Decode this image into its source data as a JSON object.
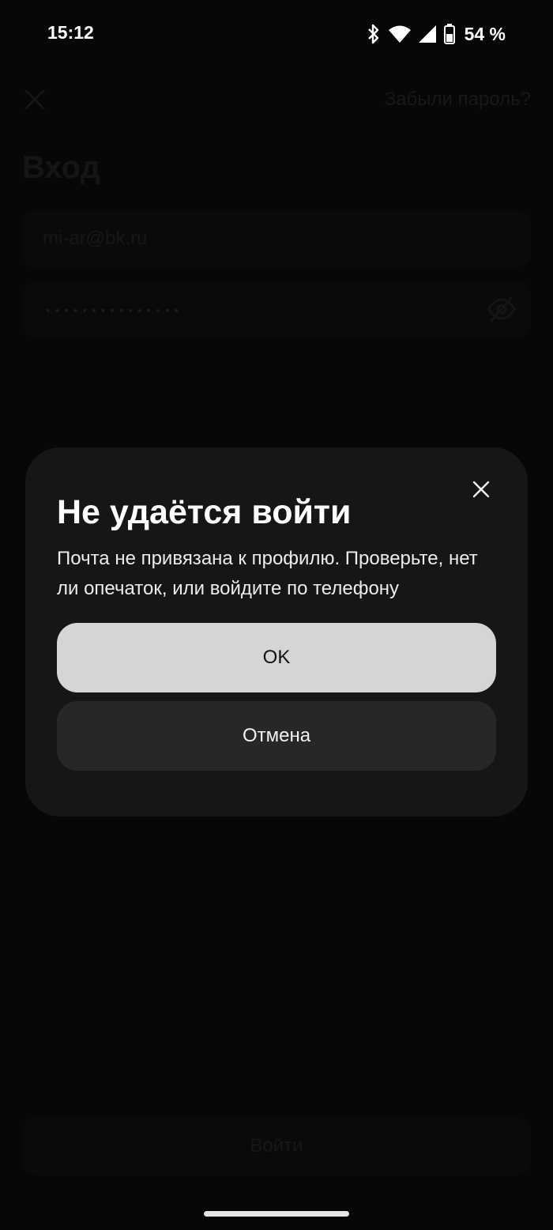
{
  "status_bar": {
    "time": "15:12",
    "battery": "54 %",
    "icons": [
      "bluetooth-icon",
      "wifi-icon",
      "signal-icon",
      "battery-icon"
    ]
  },
  "login_screen": {
    "close_icon": "close-icon",
    "forgot_password": "Забыли пароль?",
    "title": "Вход",
    "email_value": "mi-ar@bk.ru",
    "password_value": "•••••••••••••••",
    "password_toggle_icon": "eye-off-icon",
    "login_button": "Войти"
  },
  "dialog": {
    "close_icon": "close-icon",
    "title": "Не удаётся войти",
    "message": "Почта не привязана к профилю. Проверьте, нет ли опечаток, или войдите по телефону",
    "ok_label": "OK",
    "cancel_label": "Отмена"
  },
  "colors": {
    "background": "#0a0a0a",
    "dialog_bg": "#161616",
    "ok_button_bg": "#d5d5d5",
    "cancel_button_bg": "#272727"
  }
}
